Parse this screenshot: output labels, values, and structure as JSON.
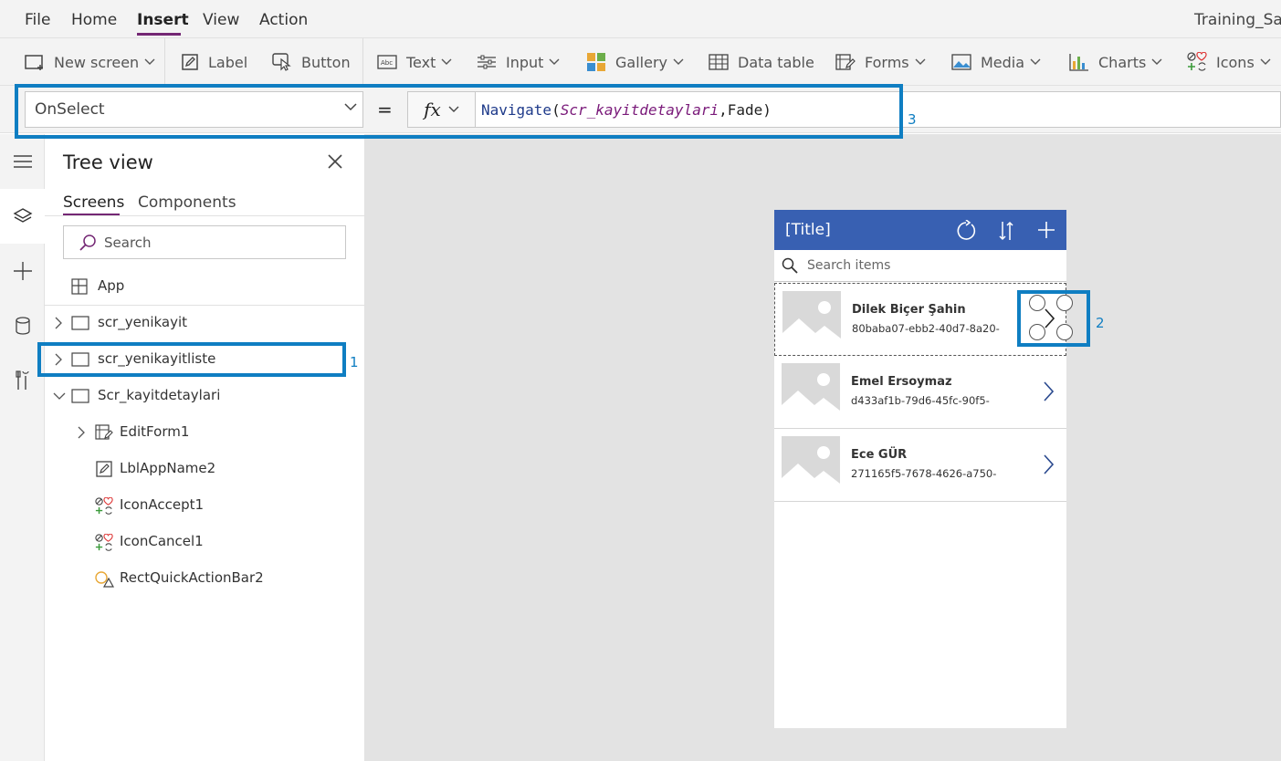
{
  "menu": {
    "items": [
      "File",
      "Home",
      "Insert",
      "View",
      "Action"
    ],
    "active": "Insert",
    "app_name": "Training_Sav"
  },
  "ribbon": {
    "new_screen": "New screen",
    "label": "Label",
    "button": "Button",
    "text": "Text",
    "input": "Input",
    "gallery": "Gallery",
    "data_table": "Data table",
    "forms": "Forms",
    "media": "Media",
    "charts": "Charts",
    "icons": "Icons"
  },
  "formula": {
    "property": "OnSelect",
    "equals": "=",
    "fx": "fx",
    "fn": "Navigate",
    "open": "(",
    "arg1": "Scr_kayitdetaylari",
    "sep": ",",
    "arg2": "Fade",
    "close": ")"
  },
  "callouts": {
    "one": "1",
    "two": "2",
    "three": "3"
  },
  "tree": {
    "title": "Tree view",
    "tabs": [
      "Screens",
      "Components"
    ],
    "search_placeholder": "Search",
    "app": "App",
    "screens": [
      "scr_yenikayit",
      "scr_yenikayitliste",
      "Scr_kayitdetaylari"
    ],
    "children": [
      "EditForm1",
      "LblAppName2",
      "IconAccept1",
      "IconCancel1",
      "RectQuickActionBar2"
    ]
  },
  "phone": {
    "title": "[Title]",
    "search_placeholder": "Search items",
    "items": [
      {
        "name": "Dilek Biçer Şahin",
        "id": "80baba07-ebb2-40d7-8a20-"
      },
      {
        "name": "Emel Ersoymaz",
        "id": "d433af1b-79d6-45fc-90f5-"
      },
      {
        "name": "Ece GÜR",
        "id": "271165f5-7678-4626-a750-"
      }
    ]
  },
  "colors": {
    "accent_purple": "#742774",
    "callout_blue": "#0f7ec2",
    "header_blue": "#3860b2"
  }
}
